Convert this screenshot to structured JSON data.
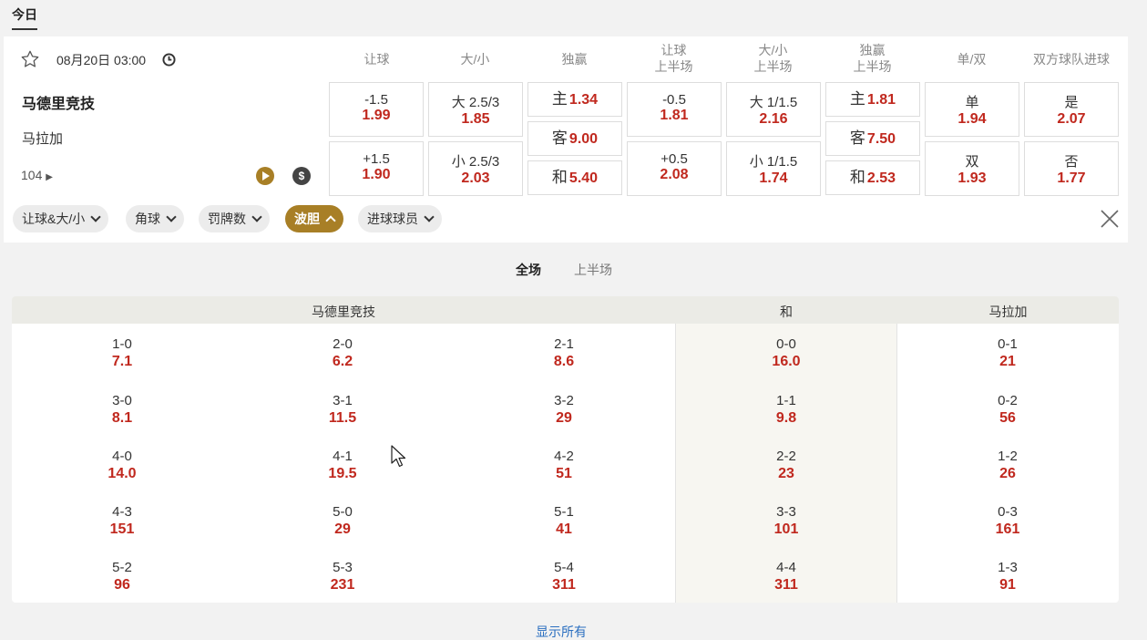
{
  "top_tab": "今日",
  "match": {
    "date": "08月20日 03:00",
    "home": "马德里竞技",
    "away": "马拉加",
    "more_count": "104",
    "money_icon_text": "$"
  },
  "columns": [
    {
      "line1": "让球",
      "line2": ""
    },
    {
      "line1": "大/小",
      "line2": ""
    },
    {
      "line1": "独赢",
      "line2": ""
    },
    {
      "line1": "让球",
      "line2": "上半场"
    },
    {
      "line1": "大/小",
      "line2": "上半场"
    },
    {
      "line1": "独赢",
      "line2": "上半场"
    },
    {
      "line1": "单/双",
      "line2": ""
    },
    {
      "line1": "双方球队进球",
      "line2": ""
    }
  ],
  "odds": {
    "handicap": [
      {
        "line": "-1.5",
        "price": "1.99"
      },
      {
        "line": "+1.5",
        "price": "1.90"
      }
    ],
    "total": [
      {
        "line": "大 2.5/3",
        "price": "1.85"
      },
      {
        "line": "小 2.5/3",
        "price": "2.03"
      }
    ],
    "moneyline": [
      {
        "label": "主",
        "price": "1.34"
      },
      {
        "label": "客",
        "price": "9.00"
      },
      {
        "label": "和",
        "price": "5.40"
      }
    ],
    "handicap_1h": [
      {
        "line": "-0.5",
        "price": "1.81"
      },
      {
        "line": "+0.5",
        "price": "2.08"
      }
    ],
    "total_1h": [
      {
        "line": "大 1/1.5",
        "price": "2.16"
      },
      {
        "line": "小 1/1.5",
        "price": "1.74"
      }
    ],
    "moneyline_1h": [
      {
        "label": "主",
        "price": "1.81"
      },
      {
        "label": "客",
        "price": "7.50"
      },
      {
        "label": "和",
        "price": "2.53"
      }
    ],
    "odd_even": [
      {
        "label": "单",
        "price": "1.94"
      },
      {
        "label": "双",
        "price": "1.93"
      }
    ],
    "btts": [
      {
        "label": "是",
        "price": "2.07"
      },
      {
        "label": "否",
        "price": "1.77"
      }
    ]
  },
  "chips": [
    {
      "label": "让球&大/小",
      "active": false
    },
    {
      "label": "角球",
      "active": false
    },
    {
      "label": "罚牌数",
      "active": false
    },
    {
      "label": "波胆",
      "active": true
    },
    {
      "label": "进球球员",
      "active": false
    }
  ],
  "sub_tabs": {
    "full": "全场",
    "half": "上半场"
  },
  "correct_score": {
    "home_header": "马德里竞技",
    "draw_header": "和",
    "away_header": "马拉加",
    "home": [
      [
        {
          "score": "1-0",
          "price": "7.1"
        },
        {
          "score": "2-0",
          "price": "6.2"
        },
        {
          "score": "2-1",
          "price": "8.6"
        }
      ],
      [
        {
          "score": "3-0",
          "price": "8.1"
        },
        {
          "score": "3-1",
          "price": "11.5"
        },
        {
          "score": "3-2",
          "price": "29"
        }
      ],
      [
        {
          "score": "4-0",
          "price": "14.0"
        },
        {
          "score": "4-1",
          "price": "19.5"
        },
        {
          "score": "4-2",
          "price": "51"
        }
      ],
      [
        {
          "score": "4-3",
          "price": "151"
        },
        {
          "score": "5-0",
          "price": "29"
        },
        {
          "score": "5-1",
          "price": "41"
        }
      ],
      [
        {
          "score": "5-2",
          "price": "96"
        },
        {
          "score": "5-3",
          "price": "231"
        },
        {
          "score": "5-4",
          "price": "311"
        }
      ]
    ],
    "draw": [
      {
        "score": "0-0",
        "price": "16.0"
      },
      {
        "score": "1-1",
        "price": "9.8"
      },
      {
        "score": "2-2",
        "price": "23"
      },
      {
        "score": "3-3",
        "price": "101"
      },
      {
        "score": "4-4",
        "price": "311"
      }
    ],
    "away": [
      {
        "score": "0-1",
        "price": "21"
      },
      {
        "score": "0-2",
        "price": "56"
      },
      {
        "score": "1-2",
        "price": "26"
      },
      {
        "score": "0-3",
        "price": "161"
      },
      {
        "score": "1-3",
        "price": "91"
      }
    ]
  },
  "show_all": "显示所有",
  "colors": {
    "accent": "#a87f26",
    "price": "#c0281e",
    "link": "#2b6fc0"
  }
}
